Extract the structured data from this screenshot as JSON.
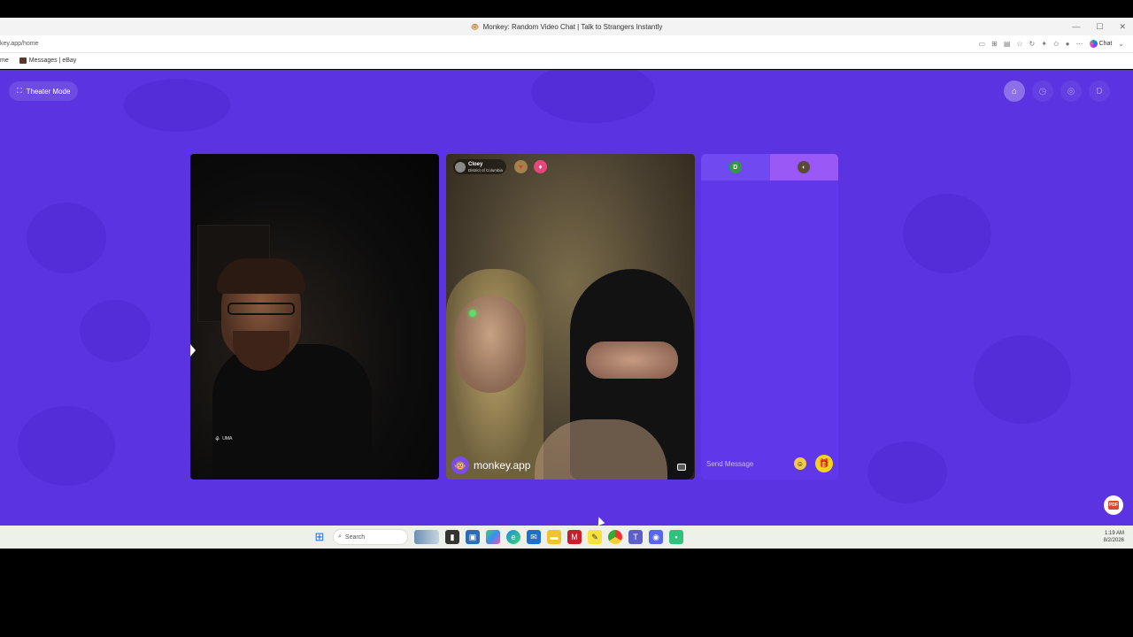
{
  "browser": {
    "window_title": "Monkey: Random Video Chat | Talk to Strangers Instantly",
    "url": "key.app/home",
    "chat_button_label": "Chat",
    "bookmarks": [
      {
        "label": "me"
      },
      {
        "label": "Messages | eBay"
      }
    ]
  },
  "page": {
    "theater_mode_label": "Theater Mode",
    "top_icons": [
      "home-icon",
      "history-icon",
      "chat-bubble-icon"
    ],
    "profile_initial": "D"
  },
  "remote_user": {
    "name": "Cloey",
    "location": "District of Columbia"
  },
  "watermark_text": "monkey.app",
  "chat": {
    "tab_initial": "D",
    "placeholder": "Send Message"
  },
  "taskbar": {
    "search_placeholder": "Search",
    "time": "1:19 AM",
    "date": "8/2/2026"
  },
  "colors": {
    "background": "#5b33e0",
    "chat_panel": "#6038ea",
    "gift_button": "#f2d41a"
  }
}
